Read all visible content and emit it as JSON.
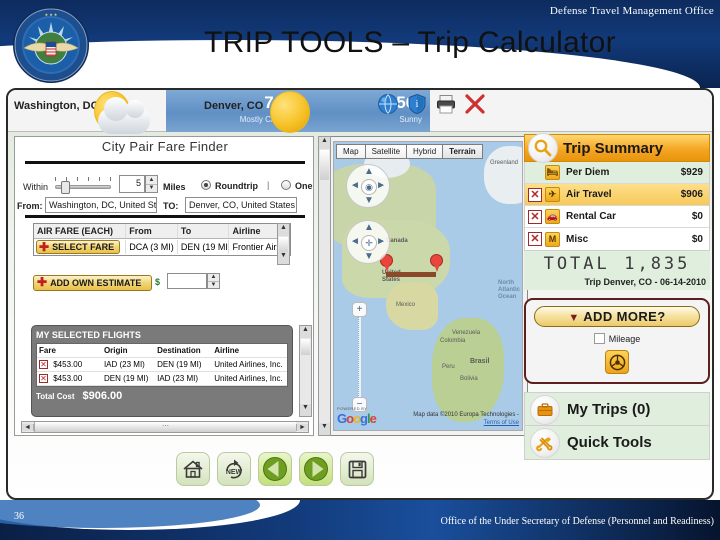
{
  "header": {
    "org": "Defense Travel Management Office",
    "title": "TRIP TOOLS – Trip Calculator",
    "seal_alt": "dod-seal"
  },
  "weather": [
    {
      "city": "Washington, DC",
      "temp": "76°",
      "condition": "Mostly Cloudy",
      "icon": "partly-cloudy-icon"
    },
    {
      "city": "Denver, CO",
      "temp": "56°",
      "condition": "Sunny",
      "icon": "sunny-icon"
    }
  ],
  "titlebar_icons": [
    {
      "name": "globe-icon"
    },
    {
      "name": "info-shield-icon"
    },
    {
      "name": "printer-icon"
    },
    {
      "name": "close-x-icon"
    }
  ],
  "fare_finder": {
    "title": "City Pair Fare Finder",
    "within_label": "Within",
    "miles_value": "5",
    "miles_label": "Miles",
    "trip_type": {
      "roundtrip": "Roundtrip",
      "separator": "|",
      "oneway": "One way",
      "selected": "Roundtrip"
    },
    "from_label": "From:",
    "from_value": "Washington, DC, United States",
    "to_label": "TO:",
    "to_value": "Denver, CO, United States",
    "results": {
      "columns": [
        "AIR FARE (EACH)",
        "From",
        "To",
        "Airline"
      ],
      "rows": [
        {
          "action": "SELECT FARE",
          "from": "DCA (3 MI)",
          "to": "DEN (19 MI)",
          "airline": "Frontier Airlines, In"
        }
      ]
    },
    "add_own_estimate": "ADD OWN ESTIMATE",
    "estimate_currency": "$",
    "estimate_value": ""
  },
  "selected_flights": {
    "title": "MY SELECTED FLIGHTS",
    "columns": [
      "Fare",
      "Origin",
      "Destination",
      "Airline"
    ],
    "rows": [
      {
        "remove": "✕",
        "fare": "$453.00",
        "origin": "IAD (23 MI)",
        "destination": "DEN (19 MI)",
        "airline": "United Airlines, Inc."
      },
      {
        "remove": "✕",
        "fare": "$453.00",
        "origin": "DEN (19 MI)",
        "destination": "IAD (23 MI)",
        "airline": "United Airlines, Inc."
      }
    ],
    "total_label": "Total Cost",
    "total_value": "$906.00"
  },
  "map": {
    "tabs": [
      "Map",
      "Satellite",
      "Hybrid",
      "Terrain"
    ],
    "selected_tab": "Terrain",
    "zoom_in": "+",
    "zoom_out": "−",
    "labels": [
      "Canada",
      "United States",
      "Mexico",
      "Greenland",
      "Venezuela",
      "Colombia",
      "Peru",
      "Brasil",
      "Bolivia",
      "North Atlantic Ocean"
    ],
    "attribution": "Map data ©2010 Europa Technologies -",
    "terms": "Terms of Use",
    "powered_by": "POWERED BY",
    "brand": "Google"
  },
  "trip_summary": {
    "title": "Trip Summary",
    "icon": "magnifier-icon",
    "items": [
      {
        "label": "Per Diem",
        "amount": "$929",
        "icon": "bed-icon",
        "removable": false,
        "highlighted": false
      },
      {
        "label": "Air Travel",
        "amount": "$906",
        "icon": "plane-icon",
        "removable": true,
        "highlighted": true
      },
      {
        "label": "Rental Car",
        "amount": "$0",
        "icon": "car-icon",
        "removable": true,
        "highlighted": false
      },
      {
        "label": "Misc",
        "amount": "$0",
        "icon": "m-icon",
        "removable": true,
        "highlighted": false
      }
    ],
    "total_label": "TOTAL",
    "total_value": "1,835",
    "trip_line": "Trip Denver, CO - 06-14-2010"
  },
  "add_more": {
    "label": "ADD MORE?",
    "mileage_label": "Mileage",
    "mileage_checked": false,
    "wheel_icon": "steering-wheel-icon"
  },
  "right_buttons": [
    {
      "label": "My Trips (0)",
      "icon": "briefcase-icon"
    },
    {
      "label": "Quick Tools",
      "icon": "tools-icon"
    }
  ],
  "toolbar": [
    {
      "name": "home-button",
      "icon": "home-icon",
      "label": ""
    },
    {
      "name": "new-button",
      "icon": "new-icon",
      "label": "NEW"
    },
    {
      "name": "back-button",
      "icon": "back-arrow-icon",
      "label": ""
    },
    {
      "name": "forward-button",
      "icon": "forward-arrow-icon",
      "label": ""
    },
    {
      "name": "save-button",
      "icon": "floppy-disk-icon",
      "label": ""
    }
  ],
  "footer": {
    "slide_number": "36",
    "text": "Office of the Under Secretary of Defense (Personnel and Readiness)"
  },
  "colors": {
    "navy": "#123a7a",
    "gold": "#f5a623",
    "green_row": "#dfeedd",
    "red": "#b02a2a"
  }
}
